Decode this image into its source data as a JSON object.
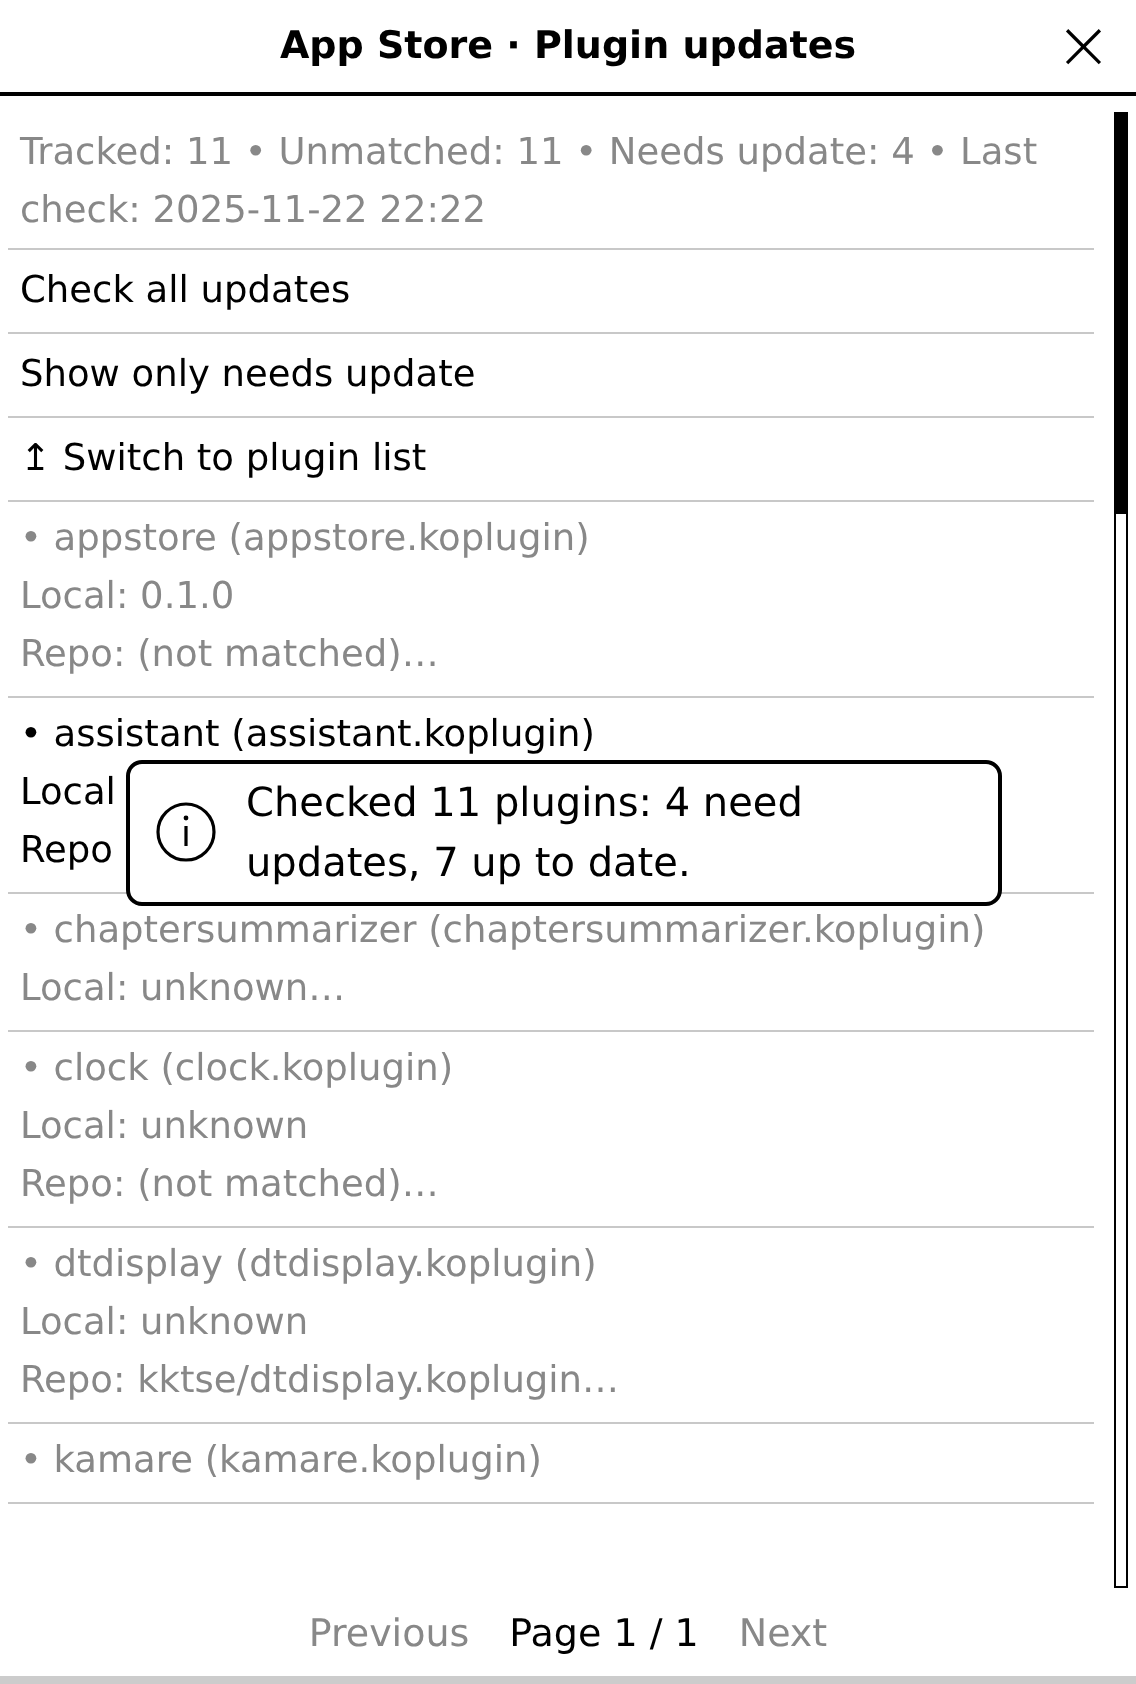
{
  "window": {
    "title": "App Store · Plugin updates",
    "close": "×"
  },
  "summary": "Tracked: 11 • Unmatched: 11 • Needs update: 4 • Last check: 2025-11-22 22:22",
  "actions": [
    "Check all updates",
    "Show only needs update",
    "↥ Switch to plugin list"
  ],
  "plugins": [
    {
      "title": "• appstore (appstore.koplugin)",
      "lines": [
        "Local: 0.1.0",
        "Repo: (not matched)…"
      ],
      "needs_update": false
    },
    {
      "title": "• assistant (assistant.koplugin)",
      "lines": [
        "Local",
        "Repo"
      ],
      "needs_update": true
    },
    {
      "title": "• chaptersummarizer (chaptersummarizer.koplugin)",
      "lines": [
        "Local: unknown…"
      ],
      "needs_update": false
    },
    {
      "title": "• clock (clock.koplugin)",
      "lines": [
        "Local: unknown",
        "Repo: (not matched)…"
      ],
      "needs_update": false
    },
    {
      "title": "• dtdisplay (dtdisplay.koplugin)",
      "lines": [
        "Local: unknown",
        "Repo: kktse/dtdisplay.koplugin…"
      ],
      "needs_update": false
    },
    {
      "title": "• kamare (kamare.koplugin)",
      "needs_update": false
    }
  ],
  "toast": {
    "message": "Checked 11 plugins: 4 need updates, 7 up to date."
  },
  "pagination": {
    "previous": {
      "label": "Previous",
      "disabled": true
    },
    "page": "Page 1 / 1",
    "next": {
      "label": "Next",
      "disabled": true
    }
  }
}
